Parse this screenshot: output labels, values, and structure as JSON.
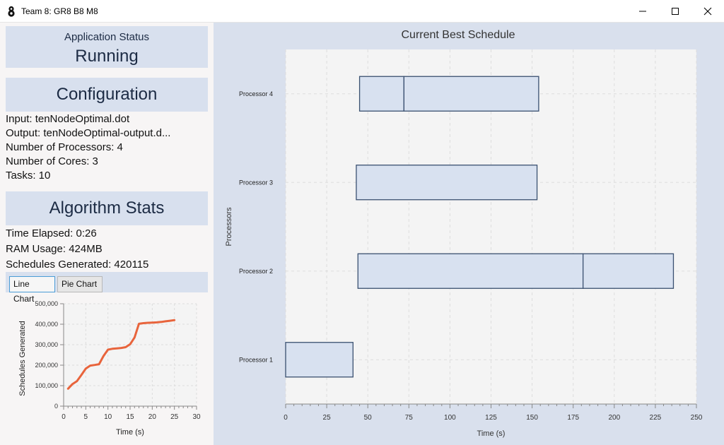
{
  "window": {
    "title": "Team 8: GR8 B8 M8"
  },
  "status": {
    "label": "Application Status",
    "value": "Running"
  },
  "configuration": {
    "heading": "Configuration",
    "lines": [
      "Input: tenNodeOptimal.dot",
      "Output: tenNodeOptimal-output.d...",
      "Number of Processors: 4",
      "Number of Cores: 3",
      "Tasks: 10"
    ]
  },
  "algorithm": {
    "heading": "Algorithm Stats",
    "lines": [
      "Time Elapsed: 0:26",
      "RAM Usage: 424MB",
      "Schedules Generated: 420115"
    ]
  },
  "tabs": [
    {
      "label": "Line Chart",
      "active": true
    },
    {
      "label": "Pie Chart",
      "active": false
    }
  ],
  "colors": {
    "line": "#e8643c",
    "bar_fill": "#d8e1f0",
    "bar_stroke": "#3a5070",
    "plot_bg": "#f4f4f4",
    "grid": "#dddddd"
  },
  "chart_data": [
    {
      "type": "line",
      "xlabel": "Time (s)",
      "ylabel": "Schedules Generated",
      "xlim": [
        0,
        30
      ],
      "ylim": [
        0,
        500000
      ],
      "x_ticks": [
        0,
        5,
        10,
        15,
        20,
        25,
        30
      ],
      "y_ticks": [
        0,
        100000,
        200000,
        300000,
        400000,
        500000
      ],
      "y_tick_labels": [
        "0",
        "100,000",
        "200,000",
        "300,000",
        "400,000",
        "500,000"
      ],
      "series": [
        {
          "x": [
            1,
            2,
            3,
            4,
            5,
            6,
            7,
            8,
            9,
            10,
            11,
            12,
            13,
            14,
            15,
            16,
            17,
            18,
            19,
            20,
            21,
            22,
            23,
            24,
            25
          ],
          "y": [
            85000,
            108000,
            122000,
            152000,
            183000,
            198000,
            201000,
            205000,
            245000,
            276000,
            280000,
            282000,
            284000,
            288000,
            302000,
            335000,
            402000,
            405000,
            407000,
            408000,
            409000,
            411000,
            414000,
            417000,
            420000
          ]
        }
      ]
    },
    {
      "type": "bar",
      "orientation": "horizontal",
      "title": "Current Best Schedule",
      "xlabel": "Time (s)",
      "ylabel": "Processors",
      "xlim": [
        0,
        250
      ],
      "x_ticks": [
        0,
        25,
        50,
        75,
        100,
        125,
        150,
        175,
        200,
        225,
        250
      ],
      "categories": [
        "Processor 1",
        "Processor 2",
        "Processor 3",
        "Processor 4"
      ],
      "tasks": [
        {
          "processor": "Processor 1",
          "start": 0,
          "end": 41
        },
        {
          "processor": "Processor 2",
          "start": 44,
          "end": 181
        },
        {
          "processor": "Processor 2",
          "start": 181,
          "end": 236
        },
        {
          "processor": "Processor 3",
          "start": 43,
          "end": 153
        },
        {
          "processor": "Processor 4",
          "start": 45,
          "end": 72
        },
        {
          "processor": "Processor 4",
          "start": 72,
          "end": 154
        }
      ]
    }
  ]
}
